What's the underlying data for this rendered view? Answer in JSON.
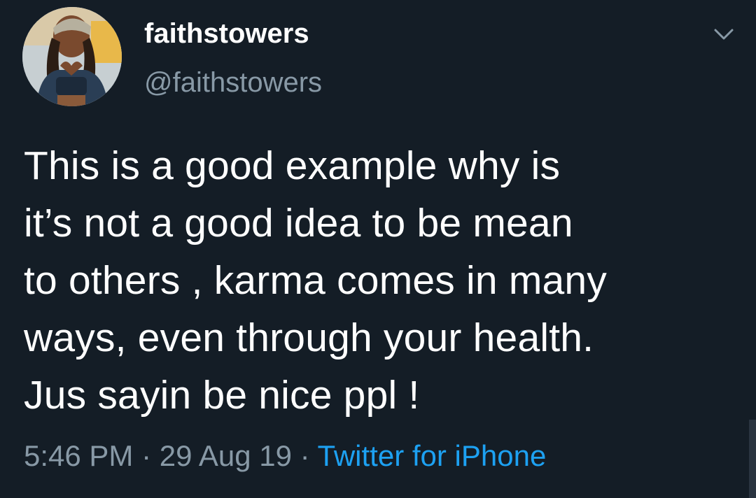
{
  "user": {
    "display_name": "faithstowers",
    "handle": "@faithstowers"
  },
  "tweet": {
    "lines": [
      "This is a good example why is",
      "it’s not a good idea to be mean",
      "to others , karma comes in many",
      "ways, even through your health.",
      "Jus sayin be nice ppl !"
    ]
  },
  "meta": {
    "time": "5:46 PM",
    "sep1": " · ",
    "date": "29 Aug 19",
    "sep2": " · ",
    "source": "Twitter for iPhone"
  },
  "icons": {
    "menu": "chevron-down-icon"
  },
  "colors": {
    "background": "#141d26",
    "primary_text": "#ffffff",
    "secondary_text": "#8899a6",
    "link": "#1da1f2"
  }
}
